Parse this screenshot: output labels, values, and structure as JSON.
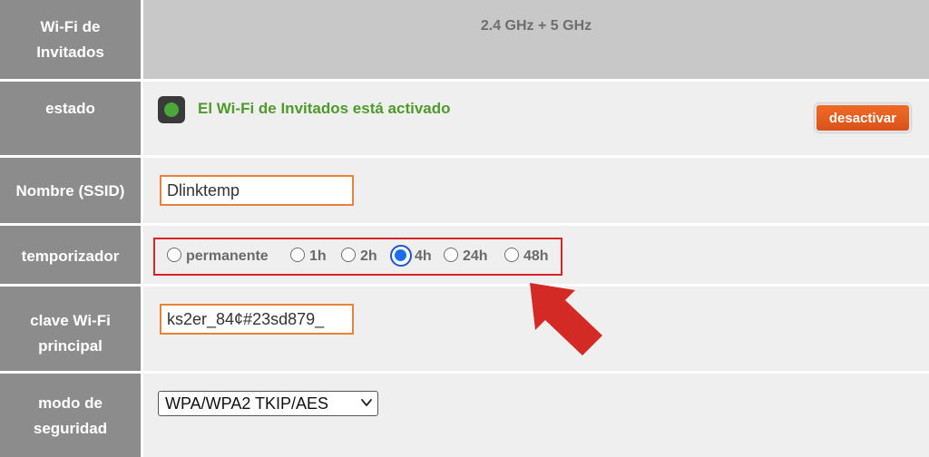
{
  "band_row": {
    "label": "Wi-Fi de Invitados",
    "value": "2.4 GHz + 5 GHz"
  },
  "status_row": {
    "label": "estado",
    "status_text": "El Wi-Fi de Invitados está activado",
    "deactivate_button": "desactivar"
  },
  "ssid_row": {
    "label": "Nombre (SSID)",
    "value": "Dlinktemp"
  },
  "timer_row": {
    "label": "temporizador",
    "options": [
      {
        "label": "permanente",
        "selected": false
      },
      {
        "label": "1h",
        "selected": false
      },
      {
        "label": "2h",
        "selected": false
      },
      {
        "label": "4h",
        "selected": true
      },
      {
        "label": "24h",
        "selected": false
      },
      {
        "label": "48h",
        "selected": false
      }
    ]
  },
  "key_row": {
    "label": "clave Wi-Fi principal",
    "value": "ks2er_84¢#23sd879_"
  },
  "security_row": {
    "label": "modo de seguridad",
    "selected": "WPA/WPA2 TKIP/AES"
  },
  "colors": {
    "label_bg": "#8c8c8c",
    "content_bg": "#efefef",
    "header_bg": "#c8c8c8",
    "accent_orange": "#e8813a",
    "status_green": "#4e9a2a",
    "highlight_red": "#d9232a",
    "radio_blue": "#1a52d8"
  },
  "icons": {
    "status_led": "green-status-led-icon",
    "select_chevron": "chevron-down-icon",
    "annotation_arrow": "red-arrow-icon"
  }
}
